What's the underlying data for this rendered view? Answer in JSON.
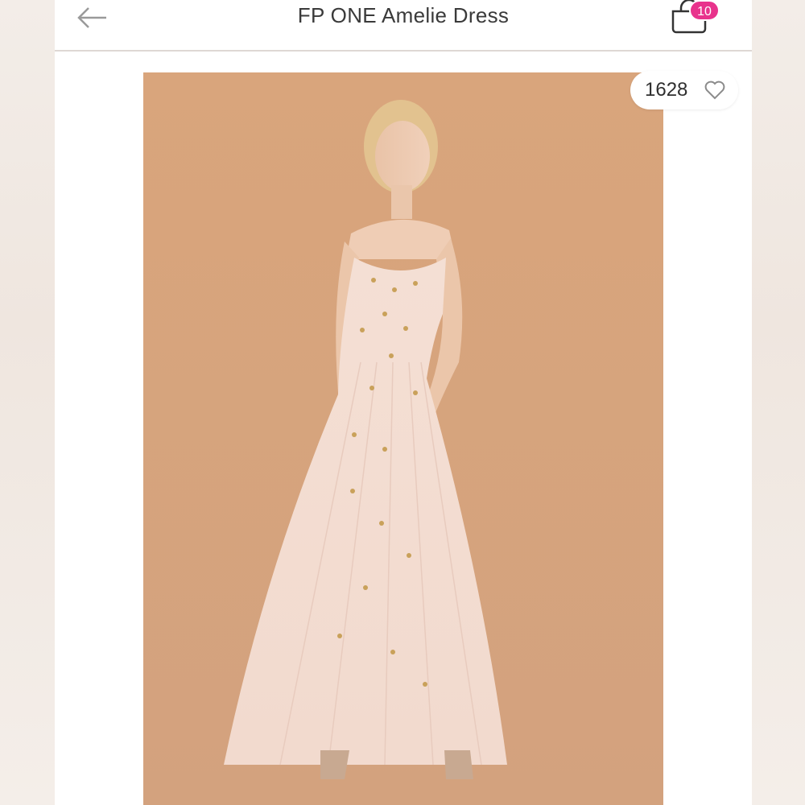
{
  "header": {
    "title": "FP ONE Amelie Dress",
    "back_icon": "arrow-left-icon",
    "cart_icon": "shopping-bag-icon",
    "cart_count": "10"
  },
  "listing": {
    "likes": "1628",
    "like_icon": "heart-outline-icon",
    "image_alt": "Model wearing blush tulle maxi dress with gold star embellishments"
  },
  "colors": {
    "accent_badge": "#e8338c",
    "photo_background": "#d6a37c",
    "dress": "#f3ddd3"
  }
}
